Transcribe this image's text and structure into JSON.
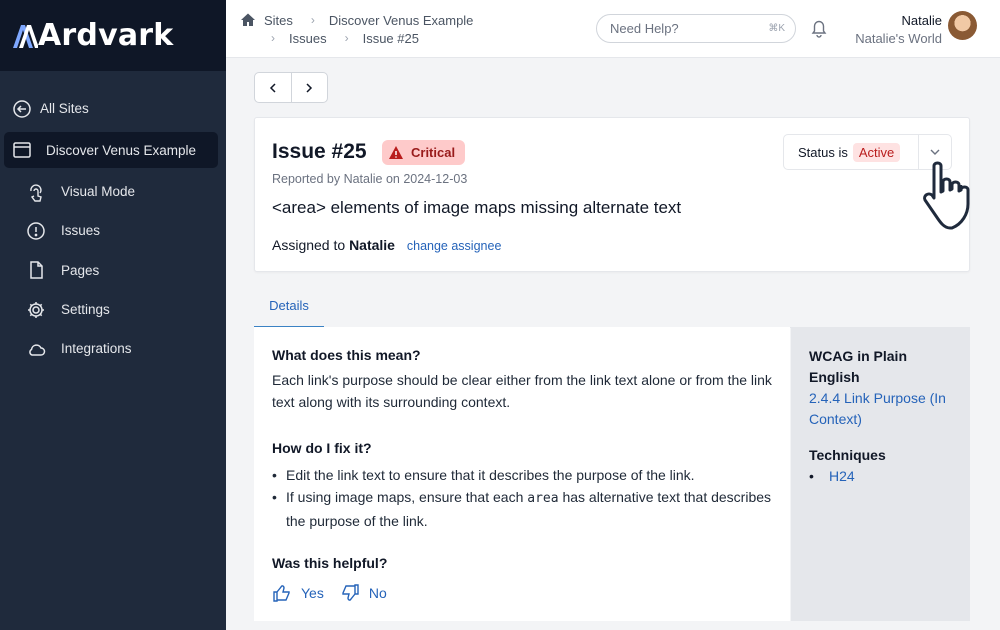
{
  "brand": {
    "logo_text": "Ardvark",
    "logo_mark": "A"
  },
  "sidebar": {
    "back_label": "All Sites",
    "site_label": "Discover Venus Example",
    "items": [
      {
        "label": "Visual Mode",
        "icon": "touch-icon"
      },
      {
        "label": "Issues",
        "icon": "alert-circle-icon"
      },
      {
        "label": "Pages",
        "icon": "page-icon"
      },
      {
        "label": "Settings",
        "icon": "gear-icon"
      },
      {
        "label": "Integrations",
        "icon": "cloud-icon"
      }
    ]
  },
  "header": {
    "breadcrumb": [
      "Sites",
      "Discover Venus Example",
      "Issues",
      "Issue #25"
    ],
    "help_placeholder": "Need Help?",
    "help_shortcut": "⌘K",
    "user_name": "Natalie",
    "user_org": "Natalie's World"
  },
  "issue": {
    "title": "Issue #25",
    "severity": "Critical",
    "reported": "Reported by Natalie on 2024-12-03",
    "description": "<area> elements of image maps missing alternate text",
    "assigned_prefix": "Assigned to",
    "assignee": "Natalie",
    "change_label": "change assignee",
    "status_prefix": "Status is",
    "status_value": "Active"
  },
  "tabs": {
    "details": "Details"
  },
  "details": {
    "meaning_title": "What does this mean?",
    "meaning_text": "Each link's purpose should be clear either from the link text alone or from the link text along with its surrounding context.",
    "fix_title": "How do I fix it?",
    "fix_item_1": "Edit the link text to ensure that it describes the purpose of the link.",
    "fix_item_2_pre": "If using image maps, ensure that each ",
    "fix_item_2_code": "area",
    "fix_item_2_post": " has alternative text that describes the purpose of the link.",
    "helpful_title": "Was this helpful?",
    "yes_label": "Yes",
    "no_label": "No"
  },
  "side": {
    "wcag_title": "WCAG in Plain English",
    "wcag_link": "2.4.4 Link Purpose (In Context)",
    "techniques_title": "Techniques",
    "technique_1": "H24"
  }
}
